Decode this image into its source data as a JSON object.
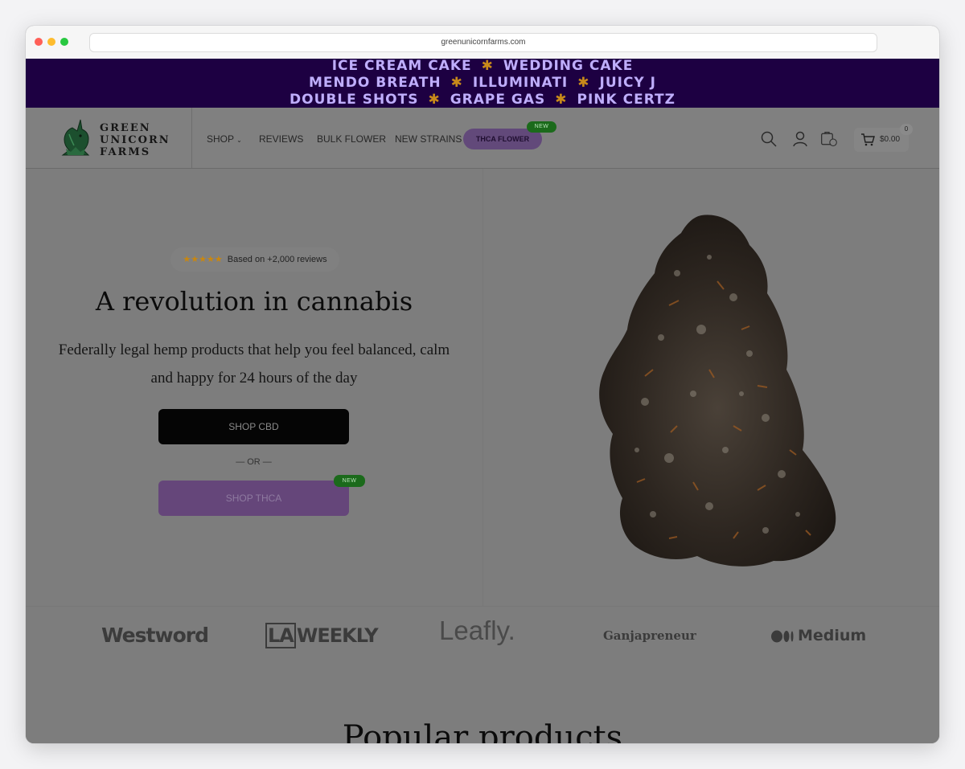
{
  "browser": {
    "url": "greenunicornfarms.com"
  },
  "ticker": {
    "lines": [
      [
        "ICE CREAM CAKE",
        "WEDDING CAKE"
      ],
      [
        "MENDO BREATH",
        "ILLUMINATI",
        "JUICY J"
      ],
      [
        "DOUBLE SHOTS",
        "GRAPE GAS",
        "PINK CERTZ"
      ]
    ],
    "separator": "✱"
  },
  "header": {
    "logo_lines": [
      "GREEN",
      "UNICORN",
      "FARMS"
    ],
    "nav": {
      "shop": "SHOP",
      "reviews": "REVIEWS",
      "bulk": "BULK FLOWER",
      "new_strains": "NEW STRAINS",
      "thca": "THCA FLOWER",
      "new_badge": "NEW"
    },
    "cart_total": "$0.00",
    "cart_count": "0",
    "icons": [
      "search-icon",
      "account-icon",
      "wishlist-icon",
      "cart-icon"
    ]
  },
  "hero": {
    "stars": "★★★★★",
    "reviews_text": "Based on +2,000 reviews",
    "title": "A revolution in cannabis",
    "subtitle": "Federally legal hemp products that help you feel balanced, calm and happy for 24 hours of the day",
    "cbd_button": "SHOP CBD",
    "or_text": "— OR —",
    "thca_button": "SHOP THCA",
    "new_badge": "NEW"
  },
  "press": {
    "westword": "Westword",
    "laweekly_la": "LA",
    "laweekly_rest": "WEEKLY",
    "leafly": "Leafly.",
    "ganjapreneur": "Ganjapreneur",
    "medium": "Medium"
  },
  "popular": {
    "title": "Popular products"
  },
  "colors": {
    "ticker_bg": "#1d0042",
    "thca_purple": "#65467a",
    "new_badge_green": "#1b6a1b",
    "star_gold": "#c9870f"
  }
}
